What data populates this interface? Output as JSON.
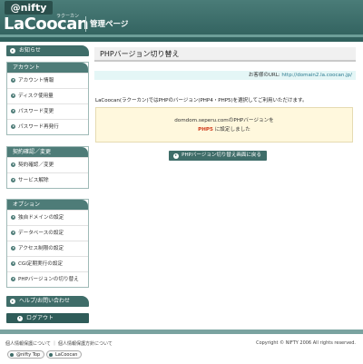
{
  "header": {
    "nifty_logo": "@nifty",
    "brand": "LaCoocan",
    "brand_ruby": "ラクーカン",
    "section_title": "管理ページ"
  },
  "sidebar": {
    "notice": "お知らせ",
    "groups": [
      {
        "title": "アカウント",
        "items": [
          "アカウント情報",
          "ディスク使用量",
          "パスワード変更",
          "パスワード再発行"
        ]
      },
      {
        "title": "契約確認／変更",
        "items": [
          "契約確認／変更",
          "サービス解除"
        ]
      },
      {
        "title": "オプション",
        "items": [
          "独自ドメインの設定",
          "データベースの設定",
          "アクセス制限の設定",
          "CGI定期実行の設定",
          "PHPバージョンの切り替え"
        ]
      }
    ],
    "help": "ヘルプ/お問い合わせ",
    "logout": "ログアウト"
  },
  "main": {
    "page_title": "PHPバージョン切り替え",
    "url_label": "お客様のURL: ",
    "url_value": "http://domain2.la.coocan.jp/",
    "description": "LaCoocan(ラクーカン)ではPHPのバージョン(PHP4・PHP5)を選択してご利用いただけます。",
    "notice_line1": "domdom.seperu.comのPHPバージョンを",
    "notice_php": "PHP5",
    "notice_line2": " に設定しました",
    "back_button": "PHPバージョン切り替え画面に戻る"
  },
  "footer": {
    "links": "個人情報保護について ｜ 個人情報保護方針について",
    "copyright": "Copyright © NIFTY 2006 All rights reserved.",
    "badge_nifty": "@nifty Top",
    "badge_lacoocan": "LaCoocan"
  },
  "colors": {
    "primary": "#3f6d69",
    "header": "#3c6b67",
    "notice_bg": "#fff8dd",
    "url_bg": "#e4f6f6",
    "php_accent": "#d03a1a"
  }
}
